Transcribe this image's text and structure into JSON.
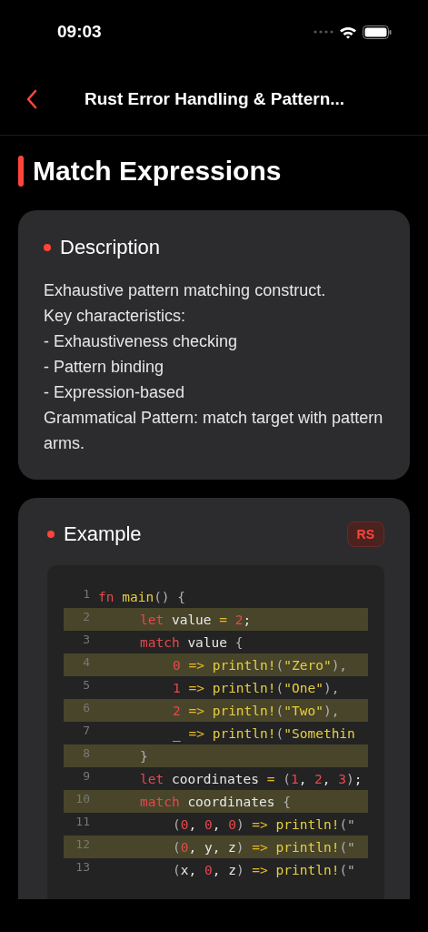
{
  "status_bar": {
    "time": "09:03"
  },
  "nav": {
    "title": "Rust Error Handling & Pattern..."
  },
  "section_title": "Match Expressions",
  "description": {
    "heading": "Description",
    "lines": [
      "Exhaustive pattern matching construct.",
      "Key characteristics:",
      "- Exhaustiveness checking",
      "- Pattern binding",
      "- Expression-based",
      "Grammatical Pattern: match target with pattern arms."
    ]
  },
  "example": {
    "heading": "Example",
    "language": "RS",
    "lines": [
      {
        "number": "1",
        "highlighted": false,
        "tokens": [
          {
            "kind": "keyword",
            "text": "fn"
          },
          {
            "kind": "function",
            "text": " main"
          },
          {
            "kind": "punctuation",
            "text": "() {"
          }
        ],
        "children": [
          {
            "number": "2",
            "highlighted": true,
            "tokens": [
              {
                "kind": "keyword",
                "text": "let"
              },
              {
                "kind": "plain",
                "text": " value "
              },
              {
                "kind": "operator",
                "text": "="
              },
              {
                "kind": "number",
                "text": " 2"
              },
              {
                "kind": "plain",
                "text": ";"
              }
            ]
          },
          {
            "number": "3",
            "highlighted": false,
            "tokens": [
              {
                "kind": "keyword",
                "text": "match"
              },
              {
                "kind": "plain",
                "text": " value "
              },
              {
                "kind": "punctuation",
                "text": "{"
              }
            ],
            "children": [
              {
                "number": "4",
                "highlighted": true,
                "tokens": [
                  {
                    "kind": "number",
                    "text": "0 "
                  },
                  {
                    "kind": "operator",
                    "text": "=> "
                  },
                  {
                    "kind": "function",
                    "text": "println!"
                  },
                  {
                    "kind": "punctuation",
                    "text": "("
                  },
                  {
                    "kind": "string",
                    "text": "\"Zero\""
                  },
                  {
                    "kind": "punctuation",
                    "text": "),"
                  }
                ]
              },
              {
                "number": "5",
                "highlighted": false,
                "tokens": [
                  {
                    "kind": "number",
                    "text": "1 "
                  },
                  {
                    "kind": "operator",
                    "text": "=> "
                  },
                  {
                    "kind": "function",
                    "text": "println!"
                  },
                  {
                    "kind": "punctuation",
                    "text": "("
                  },
                  {
                    "kind": "string",
                    "text": "\"One\""
                  },
                  {
                    "kind": "punctuation",
                    "text": "),"
                  }
                ]
              },
              {
                "number": "6",
                "highlighted": true,
                "tokens": [
                  {
                    "kind": "number",
                    "text": "2 "
                  },
                  {
                    "kind": "operator",
                    "text": "=> "
                  },
                  {
                    "kind": "function",
                    "text": "println!"
                  },
                  {
                    "kind": "punctuation",
                    "text": "("
                  },
                  {
                    "kind": "string",
                    "text": "\"Two\""
                  },
                  {
                    "kind": "punctuation",
                    "text": "),"
                  }
                ]
              },
              {
                "number": "7",
                "highlighted": false,
                "tokens": [
                  {
                    "kind": "plain",
                    "text": "_ "
                  },
                  {
                    "kind": "operator",
                    "text": "=> "
                  },
                  {
                    "kind": "function",
                    "text": "println!"
                  },
                  {
                    "kind": "punctuation",
                    "text": "("
                  },
                  {
                    "kind": "string",
                    "text": "\"Somethin"
                  }
                ]
              }
            ]
          },
          {
            "number": "8",
            "highlighted": true,
            "tokens": [
              {
                "kind": "punctuation",
                "text": "}"
              }
            ]
          },
          {
            "number": "9",
            "highlighted": false,
            "tokens": [
              {
                "kind": "keyword",
                "text": "let"
              },
              {
                "kind": "plain",
                "text": " coordinates "
              },
              {
                "kind": "operator",
                "text": "="
              },
              {
                "kind": "punctuation",
                "text": " ("
              },
              {
                "kind": "number",
                "text": "1"
              },
              {
                "kind": "plain",
                "text": ", "
              },
              {
                "kind": "number",
                "text": "2"
              },
              {
                "kind": "plain",
                "text": ", "
              },
              {
                "kind": "number",
                "text": "3"
              },
              {
                "kind": "punctuation",
                "text": ")"
              },
              {
                "kind": "plain",
                "text": ";"
              }
            ]
          },
          {
            "number": "10",
            "highlighted": true,
            "tokens": [
              {
                "kind": "keyword",
                "text": "match"
              },
              {
                "kind": "plain",
                "text": " coordinates "
              },
              {
                "kind": "punctuation",
                "text": "{"
              }
            ],
            "children": [
              {
                "number": "11",
                "highlighted": false,
                "tokens": [
                  {
                    "kind": "punctuation",
                    "text": "("
                  },
                  {
                    "kind": "number",
                    "text": "0"
                  },
                  {
                    "kind": "plain",
                    "text": ", "
                  },
                  {
                    "kind": "number",
                    "text": "0"
                  },
                  {
                    "kind": "plain",
                    "text": ", "
                  },
                  {
                    "kind": "number",
                    "text": "0"
                  },
                  {
                    "kind": "punctuation",
                    "text": ") "
                  },
                  {
                    "kind": "operator",
                    "text": "=> "
                  },
                  {
                    "kind": "function",
                    "text": "println!"
                  },
                  {
                    "kind": "punctuation",
                    "text": "(\""
                  }
                ]
              },
              {
                "number": "12",
                "highlighted": true,
                "tokens": [
                  {
                    "kind": "punctuation",
                    "text": "("
                  },
                  {
                    "kind": "number",
                    "text": "0"
                  },
                  {
                    "kind": "plain",
                    "text": ", y, z"
                  },
                  {
                    "kind": "punctuation",
                    "text": ") "
                  },
                  {
                    "kind": "operator",
                    "text": "=> "
                  },
                  {
                    "kind": "function",
                    "text": "println!"
                  },
                  {
                    "kind": "punctuation",
                    "text": "(\""
                  }
                ]
              },
              {
                "number": "13",
                "highlighted": false,
                "tokens": [
                  {
                    "kind": "punctuation",
                    "text": "("
                  },
                  {
                    "kind": "plain",
                    "text": "x, "
                  },
                  {
                    "kind": "number",
                    "text": "0"
                  },
                  {
                    "kind": "plain",
                    "text": ", z"
                  },
                  {
                    "kind": "punctuation",
                    "text": ") "
                  },
                  {
                    "kind": "operator",
                    "text": "=> "
                  },
                  {
                    "kind": "function",
                    "text": "println!"
                  },
                  {
                    "kind": "punctuation",
                    "text": "(\""
                  }
                ]
              }
            ]
          }
        ]
      }
    ]
  }
}
